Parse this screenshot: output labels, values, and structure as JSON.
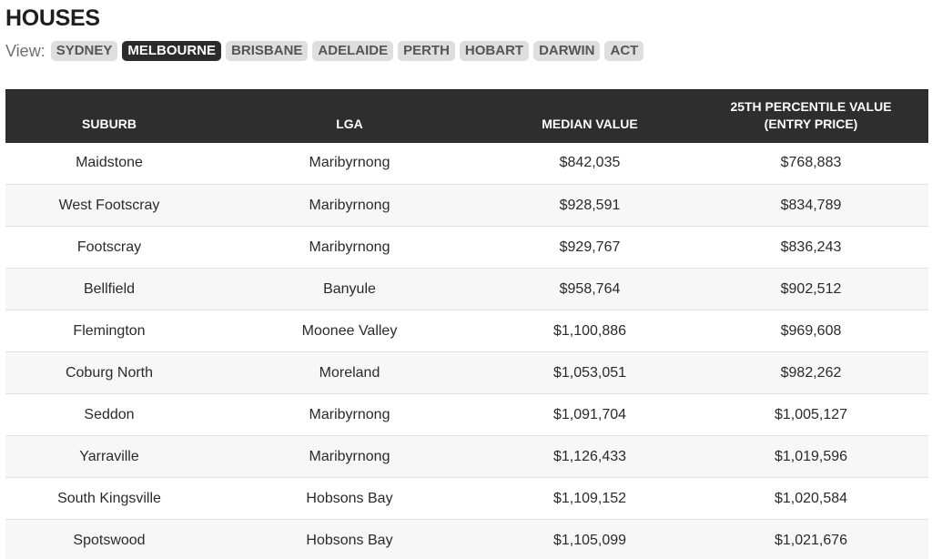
{
  "title": "HOUSES",
  "view": {
    "label": "View:",
    "tabs": [
      {
        "label": "SYDNEY",
        "active": false
      },
      {
        "label": "MELBOURNE",
        "active": true
      },
      {
        "label": "BRISBANE",
        "active": false
      },
      {
        "label": "ADELAIDE",
        "active": false
      },
      {
        "label": "PERTH",
        "active": false
      },
      {
        "label": "HOBART",
        "active": false
      },
      {
        "label": "DARWIN",
        "active": false
      },
      {
        "label": "ACT",
        "active": false
      }
    ]
  },
  "table": {
    "headers": [
      "SUBURB",
      "LGA",
      "MEDIAN VALUE",
      "25TH PERCENTILE VALUE\n(ENTRY PRICE)"
    ],
    "rows": [
      [
        "Maidstone",
        "Maribyrnong",
        "$842,035",
        "$768,883"
      ],
      [
        "West Footscray",
        "Maribyrnong",
        "$928,591",
        "$834,789"
      ],
      [
        "Footscray",
        "Maribyrnong",
        "$929,767",
        "$836,243"
      ],
      [
        "Bellfield",
        "Banyule",
        "$958,764",
        "$902,512"
      ],
      [
        "Flemington",
        "Moonee Valley",
        "$1,100,886",
        "$969,608"
      ],
      [
        "Coburg North",
        "Moreland",
        "$1,053,051",
        "$982,262"
      ],
      [
        "Seddon",
        "Maribyrnong",
        "$1,091,704",
        "$1,005,127"
      ],
      [
        "Yarraville",
        "Maribyrnong",
        "$1,126,433",
        "$1,019,596"
      ],
      [
        "South Kingsville",
        "Hobsons Bay",
        "$1,109,152",
        "$1,020,584"
      ],
      [
        "Spotswood",
        "Hobsons Bay",
        "$1,105,099",
        "$1,021,676"
      ]
    ]
  },
  "colors": {
    "header_bg": "#2e2e2e",
    "active_tab_bg": "#2b2b2b",
    "tab_bg": "#dedede",
    "row_alt_bg": "#f7f7f7"
  }
}
